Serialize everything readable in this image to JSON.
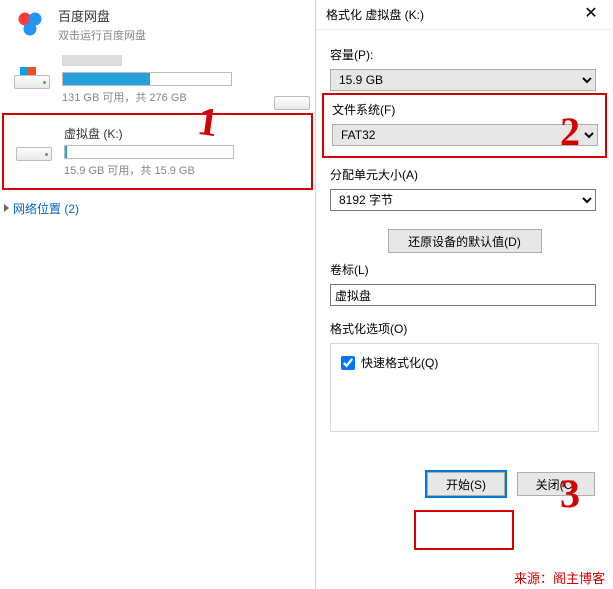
{
  "app": {
    "title": "百度网盘",
    "subtitle": "双击运行百度网盘"
  },
  "drives": [
    {
      "name_hidden": true,
      "sub": "131 GB 可用，共 276 GB",
      "fill_pct": 52,
      "win": true
    },
    {
      "name": "虚拟盘 (K:)",
      "sub": "15.9 GB 可用，共 15.9 GB",
      "fill_pct": 1,
      "selected": true
    }
  ],
  "network": {
    "label": "网络位置 (2)"
  },
  "dialog": {
    "title": "格式化 虚拟盘 (K:)",
    "capacity_label": "容量(P):",
    "capacity_value": "15.9 GB",
    "fs_label": "文件系统(F)",
    "fs_value": "FAT32",
    "alloc_label": "分配单元大小(A)",
    "alloc_value": "8192 字节",
    "restore_label": "还原设备的默认值(D)",
    "volume_label": "卷标(L)",
    "volume_value": "虚拟盘",
    "options_legend": "格式化选项(O)",
    "quick_label": "快速格式化(Q)",
    "start_label": "开始(S)",
    "close_label": "关闭(C)"
  },
  "annotations": {
    "d1": "1",
    "d2": "2",
    "d3": "3",
    "source": "来源：阁主博客"
  }
}
